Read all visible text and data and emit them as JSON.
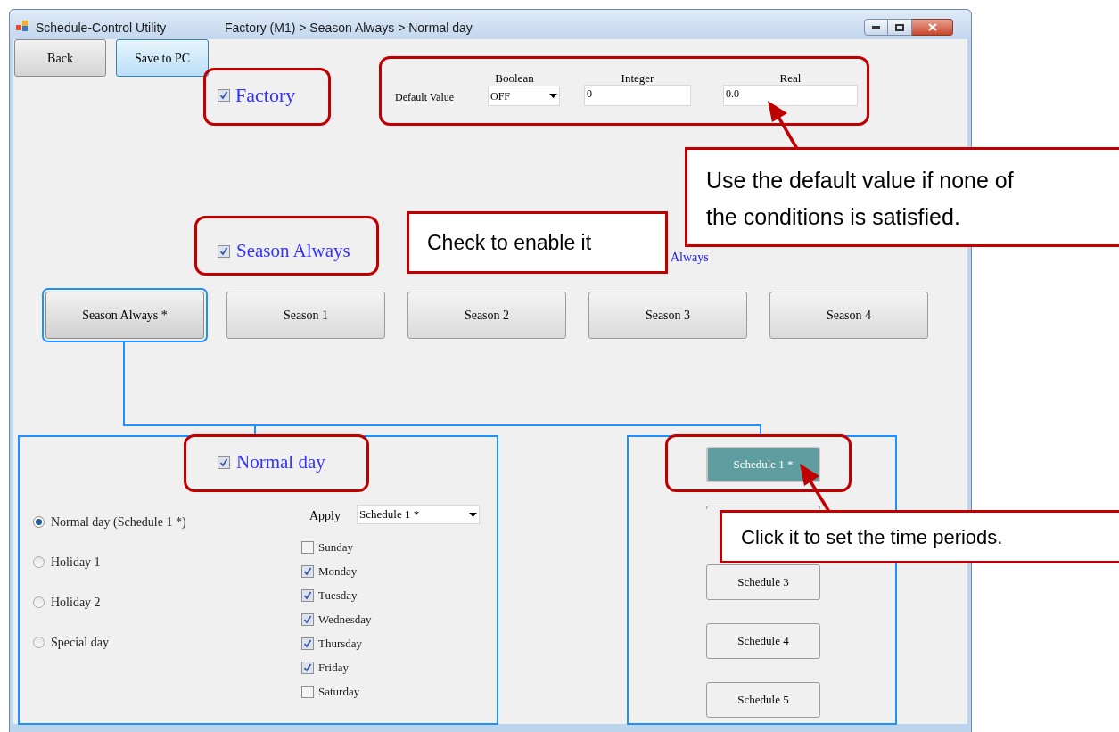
{
  "window": {
    "title": "Schedule-Control Utility",
    "breadcrumb": "Factory (M1) > Season Always > Normal day"
  },
  "toolbar": [
    {
      "label": "Back",
      "kind": "normal"
    },
    {
      "label": "Save to PC",
      "kind": "highlighted"
    }
  ],
  "factory": {
    "label": "Factory",
    "checked": true
  },
  "default_value": {
    "label": "Default Value",
    "boolean": {
      "label": "Boolean",
      "value": "OFF"
    },
    "integer": {
      "label": "Integer",
      "value": "0"
    },
    "real": {
      "label": "Real",
      "value": "0.0"
    }
  },
  "season": {
    "label": "Season Always",
    "checked": true,
    "hidden_caption": "Always"
  },
  "season_tabs": [
    {
      "label": "Season Always *",
      "selected": true
    },
    {
      "label": "Season 1",
      "selected": false
    },
    {
      "label": "Season 2",
      "selected": false
    },
    {
      "label": "Season 3",
      "selected": false
    },
    {
      "label": "Season 4",
      "selected": false
    }
  ],
  "day_panel": {
    "label": "Normal day",
    "checked": true,
    "day_types": [
      {
        "label": "Normal day (Schedule 1 *)",
        "selected": true
      },
      {
        "label": "Holiday 1",
        "selected": false
      },
      {
        "label": "Holiday 2",
        "selected": false
      },
      {
        "label": "Special day",
        "selected": false
      }
    ],
    "apply": {
      "label": "Apply",
      "value": "Schedule 1 *"
    },
    "weekdays": [
      {
        "label": "Sunday",
        "checked": false
      },
      {
        "label": "Monday",
        "checked": true
      },
      {
        "label": "Tuesday",
        "checked": true
      },
      {
        "label": "Wednesday",
        "checked": true
      },
      {
        "label": "Thursday",
        "checked": true
      },
      {
        "label": "Friday",
        "checked": true
      },
      {
        "label": "Saturday",
        "checked": false
      }
    ]
  },
  "schedules": [
    {
      "label": "Schedule 1 *",
      "selected": true
    },
    {
      "selected": false
    },
    {
      "label": "Schedule 3",
      "selected": false
    },
    {
      "label": "Schedule 4",
      "selected": false
    },
    {
      "label": "Schedule 5",
      "selected": false
    }
  ],
  "callouts": [
    {
      "text": "Use the default value if none of the conditions is satisfied."
    },
    {
      "text": "Check to enable it"
    },
    {
      "text": "Click it to set the time periods."
    }
  ]
}
